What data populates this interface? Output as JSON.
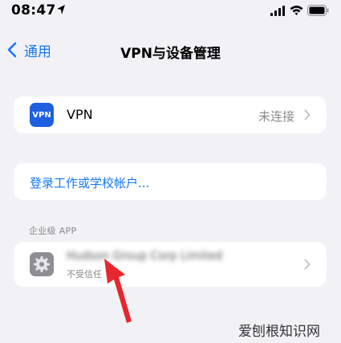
{
  "status_bar": {
    "time": "08:47"
  },
  "nav": {
    "back_label": "通用",
    "title": "VPN与设备管理"
  },
  "vpn_row": {
    "icon_text": "VPN",
    "label": "VPN",
    "status": "未连接"
  },
  "login_row": {
    "label": "登录工作或学校帐户..."
  },
  "enterprise": {
    "header": "企业级 APP",
    "app_name": "Hudson Group Corp Limited",
    "app_subtitle": "不受信任"
  },
  "watermark": "爱刨根知识网",
  "colors": {
    "accent": "#1478f5",
    "background": "#f2f2f6",
    "arrow": "#e8262e"
  },
  "icons": [
    "location-icon",
    "signal-icon",
    "wifi-icon",
    "battery-icon",
    "chevron-left-icon",
    "chevron-right-icon",
    "gear-icon",
    "arrow-annotation"
  ]
}
